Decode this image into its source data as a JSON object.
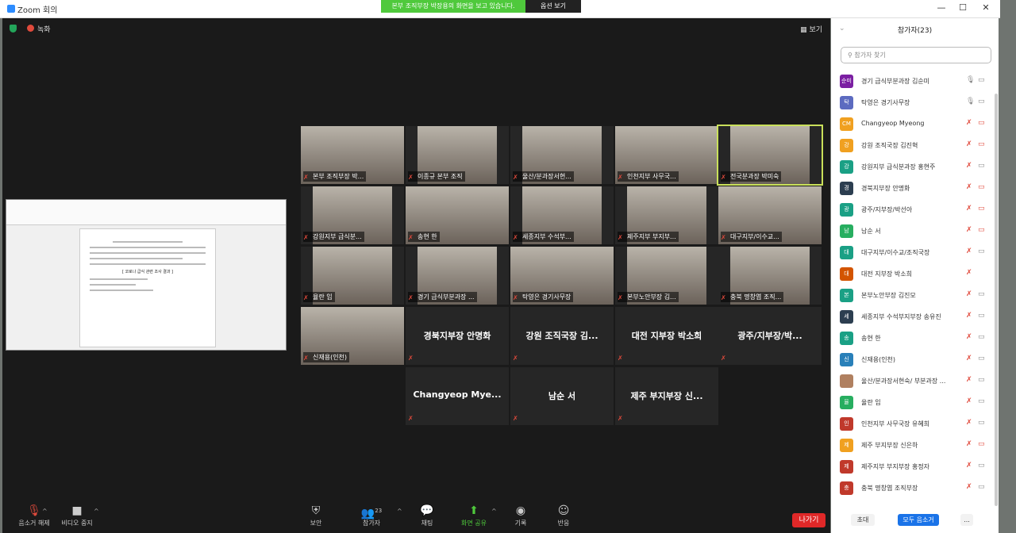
{
  "window": {
    "title": "Zoom 회의",
    "banner": "본부 조직부장 박장용의 화면을 보고 있습니다.",
    "view_options": "옵션 보기",
    "minimize": "—",
    "maximize": "☐",
    "close": "✕"
  },
  "meeting": {
    "record_label": "녹화",
    "view_label": "보기"
  },
  "shared_doc": {
    "caption": "[ 코로나 급식 관련 조사 결과 ]"
  },
  "tiles": [
    {
      "name": "본부 조직부장 박...",
      "video": true
    },
    {
      "name": "이종규 본부 조직",
      "video": true
    },
    {
      "name": "울산/분과장서현...",
      "video": true
    },
    {
      "name": "인천지부 사무국...",
      "video": true
    },
    {
      "name": "전국분과장 박미숙",
      "video": true,
      "active": true
    },
    {
      "name": "강원지부 급식분...",
      "video": true
    },
    {
      "name": "송현 한",
      "video": true
    },
    {
      "name": "세종지부 수석부...",
      "video": true
    },
    {
      "name": "제주지부 부지부...",
      "video": true
    },
    {
      "name": "대구지부/이수교...",
      "video": true
    },
    {
      "name": "율란 임",
      "video": true
    },
    {
      "name": "경기 급식부분과장 ...",
      "video": true
    },
    {
      "name": "탁영은 경기사무장",
      "video": true
    },
    {
      "name": "본부노안부장 김...",
      "video": true
    },
    {
      "name": "충북 명창엽 조직...",
      "video": true
    },
    {
      "name": "신재용(인천)",
      "video": true
    },
    {
      "name": "경북지부장 안명화",
      "video": false
    },
    {
      "name": "강원 조직국장 김...",
      "video": false
    },
    {
      "name": "대전 지부장 박소희",
      "video": false
    },
    {
      "name": "광주/지부장/박...",
      "video": false
    },
    {
      "name": "Changyeop  Mye...",
      "video": false
    },
    {
      "name": "남순 서",
      "video": false
    },
    {
      "name": "제주 부지부장 신...",
      "video": false
    }
  ],
  "toolbar": {
    "unmute": "음소거 해제",
    "stop_video": "비디오 중지",
    "security": "보안",
    "participants": "참가자",
    "participants_count": "23",
    "chat": "채팅",
    "share": "화면 공유",
    "record": "기록",
    "reactions": "반응",
    "leave": "나가기"
  },
  "sidebar": {
    "title": "참가자(23)",
    "search_placeholder": "참가자 찾기",
    "invite": "초대",
    "mute_all": "모두 음소거",
    "more": "...",
    "participants": [
      {
        "initial": "순미",
        "name": "경기 급식부분과장 김순미",
        "color": "#7b1fa2",
        "muted": false,
        "video_off": false
      },
      {
        "initial": "탁",
        "name": "탁영은 경기사무장",
        "color": "#5c6bc0",
        "muted": false,
        "video_off": false
      },
      {
        "initial": "CM",
        "name": "Changyeop Myeong",
        "color": "#f0a020",
        "muted": true,
        "video_off": true
      },
      {
        "initial": "강",
        "name": "강원 조직국장 김진혁",
        "color": "#f0a020",
        "muted": true,
        "video_off": true
      },
      {
        "initial": "강",
        "name": "강원지부 급식분과장 홍현주",
        "color": "#1aa085",
        "muted": true,
        "video_off": false
      },
      {
        "initial": "경",
        "name": "경북지부장 안명화",
        "color": "#2c3e50",
        "muted": true,
        "video_off": true
      },
      {
        "initial": "광",
        "name": "광주/지부장/박선아",
        "color": "#1aa085",
        "muted": true,
        "video_off": true
      },
      {
        "initial": "남",
        "name": "남순 서",
        "color": "#27ae60",
        "muted": true,
        "video_off": true
      },
      {
        "initial": "대",
        "name": "대구지부/이수교/조직국장",
        "color": "#1aa085",
        "muted": true,
        "video_off": false
      },
      {
        "initial": "대",
        "name": "대전 지부장 박소희",
        "color": "#d35400",
        "muted": true,
        "video_off": null
      },
      {
        "initial": "본",
        "name": "본부노안부장 김진모",
        "color": "#1aa085",
        "muted": true,
        "video_off": false
      },
      {
        "initial": "세",
        "name": "세종지부 수석부지부장   송유진",
        "color": "#2c3e50",
        "muted": true,
        "video_off": false
      },
      {
        "initial": "송",
        "name": "송현 한",
        "color": "#1aa085",
        "muted": true,
        "video_off": false
      },
      {
        "initial": "신",
        "name": "신재용(인천)",
        "color": "#2980b9",
        "muted": true,
        "video_off": false
      },
      {
        "initial": "",
        "name": "울산/분과장서현숙/ 부분과장 ...",
        "color": "#b08060",
        "muted": true,
        "video_off": false
      },
      {
        "initial": "율",
        "name": "율란 임",
        "color": "#27ae60",
        "muted": true,
        "video_off": false
      },
      {
        "initial": "인",
        "name": "인천지부 사무국장 유혜희",
        "color": "#c0392b",
        "muted": true,
        "video_off": false
      },
      {
        "initial": "제",
        "name": "제주 부지부장 신은하",
        "color": "#f0a020",
        "muted": true,
        "video_off": true
      },
      {
        "initial": "제",
        "name": "제주지부 부지부장 홍정자",
        "color": "#c0392b",
        "muted": true,
        "video_off": false
      },
      {
        "initial": "충",
        "name": "충북 명창엽 조직부장",
        "color": "#c0392b",
        "muted": true,
        "video_off": false
      }
    ]
  }
}
